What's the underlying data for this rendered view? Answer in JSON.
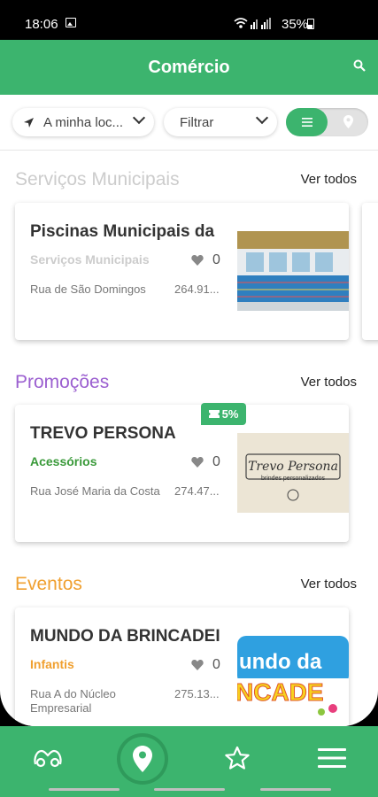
{
  "status_bar": {
    "time": "18:06",
    "battery": "35%"
  },
  "header": {
    "title": "Comércio",
    "search_icon": "search-icon"
  },
  "filters": {
    "location_label": "A minha loc...",
    "filter_label": "Filtrar",
    "view_toggle": [
      "list-icon",
      "map-pin-icon"
    ]
  },
  "sections": [
    {
      "title": "Serviços Municipais",
      "title_color": "#cccccc",
      "see_all": "Ver todos",
      "card": {
        "name": "Piscinas Municipais da",
        "category": "Serviços Municipais",
        "category_color": "#cccccc",
        "likes": "0",
        "address": "Rua de São Domingos",
        "distance": "264.91..."
      }
    },
    {
      "title": "Promoções",
      "title_color": "#9b5fd0",
      "see_all": "Ver todos",
      "card": {
        "name": "TREVO PERSONA",
        "category": "Acessórios",
        "category_color": "#3a9a3a",
        "likes": "0",
        "address": "Rua José Maria da Costa",
        "distance": "274.47...",
        "badge": "5%",
        "thumb_text_1": "Trevo Persona",
        "thumb_text_2": "brindes personalizados"
      }
    },
    {
      "title": "Eventos",
      "title_color": "#f0a030",
      "see_all": "Ver todos",
      "card": {
        "name": "MUNDO DA BRINCADEI",
        "category": "Infantis",
        "category_color": "#f0a030",
        "likes": "0",
        "address": "Rua A do Núcleo Empresarial",
        "distance": "275.13...",
        "thumb_text_1": "undo da",
        "thumb_text_2": "NCADE"
      }
    }
  ],
  "colors": {
    "brand_green": "#3cb46e"
  },
  "nav": {
    "items": [
      "binoculars-icon",
      "map-pin-icon",
      "star-icon",
      "menu-icon"
    ]
  }
}
